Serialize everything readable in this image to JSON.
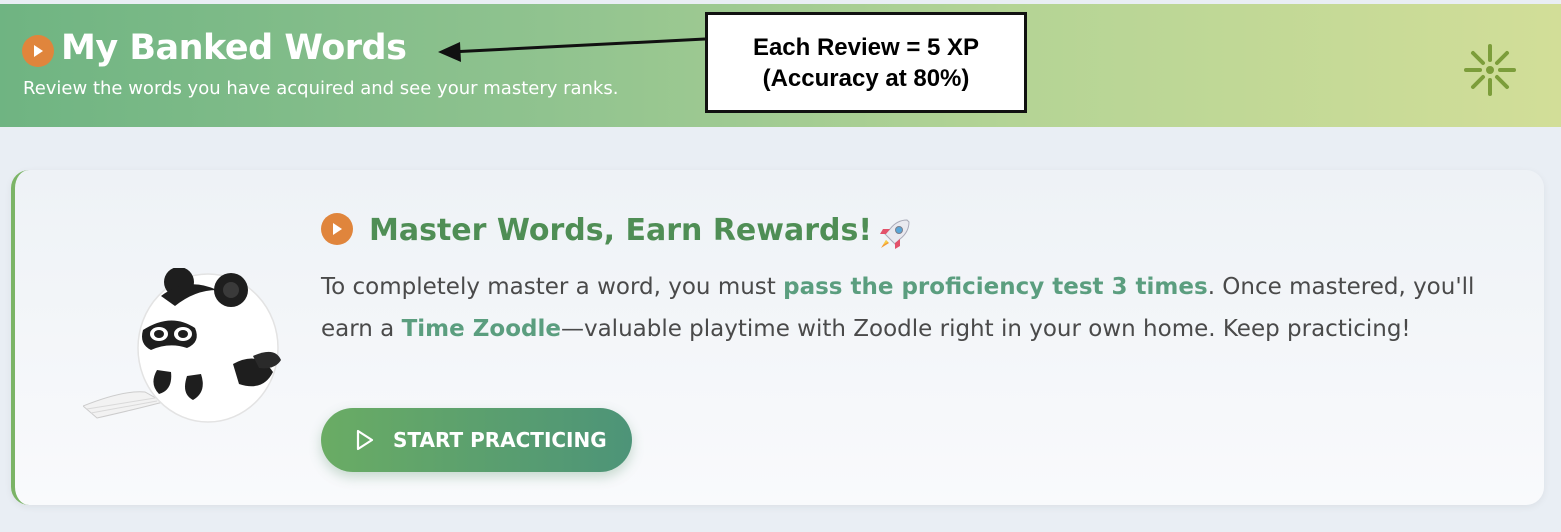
{
  "header": {
    "title": "My Banked Words",
    "subtitle": "Review the words you have acquired and see your mastery ranks."
  },
  "callout": {
    "line1": "Each Review = 5 XP",
    "line2": "(Accuracy at 80%)"
  },
  "card": {
    "title": "Master Words, Earn Rewards!",
    "body": {
      "part1": "To completely master a word, you must ",
      "highlight1": "pass the proficiency test 3 times",
      "part2": ". Once mastered, you'll earn a ",
      "highlight2": "Time Zoodle",
      "part3": "—valuable playtime with Zoodle right in your own home. Keep practicing!"
    },
    "button_label": "START PRACTICING"
  },
  "icons": {
    "header_play": "play-circle-icon",
    "flower": "sparkle-flower-icon",
    "card_play": "play-circle-icon",
    "rocket": "rocket-icon",
    "button": "play-outline-icon",
    "mascot": "panda-mascot-illustration"
  },
  "colors": {
    "accent_orange": "#e0853c",
    "title_green": "#4f8e55",
    "highlight_teal": "#5b9e7f",
    "header_gradient_start": "#6fb482",
    "header_gradient_end": "#d2de98"
  }
}
